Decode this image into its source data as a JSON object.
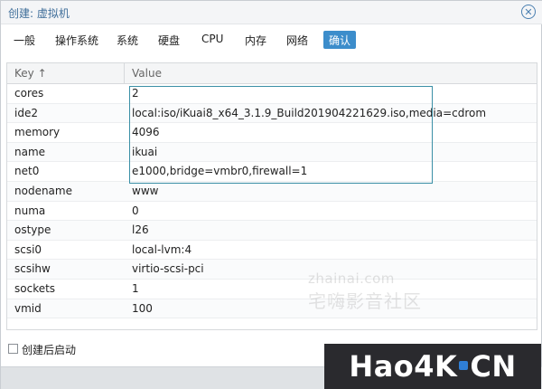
{
  "dialog": {
    "title": "创建: 虚拟机"
  },
  "tabs": [
    {
      "label": "一般"
    },
    {
      "label": "操作系统"
    },
    {
      "label": "系统"
    },
    {
      "label": "硬盘"
    },
    {
      "label": "CPU"
    },
    {
      "label": "内存"
    },
    {
      "label": "网络"
    },
    {
      "label": "确认"
    }
  ],
  "active_tab": "确认",
  "grid": {
    "columns": {
      "key": "Key ↑",
      "value": "Value"
    },
    "rows": [
      {
        "key": "cores",
        "value": "2"
      },
      {
        "key": "ide2",
        "value": "local:iso/iKuai8_x64_3.1.9_Build201904221629.iso,media=cdrom"
      },
      {
        "key": "memory",
        "value": "4096"
      },
      {
        "key": "name",
        "value": "ikuai"
      },
      {
        "key": "net0",
        "value": "e1000,bridge=vmbr0,firewall=1"
      },
      {
        "key": "nodename",
        "value": "www"
      },
      {
        "key": "numa",
        "value": "0"
      },
      {
        "key": "ostype",
        "value": "l26"
      },
      {
        "key": "scsi0",
        "value": "local-lvm:4"
      },
      {
        "key": "scsihw",
        "value": "virtio-scsi-pci"
      },
      {
        "key": "sockets",
        "value": "1"
      },
      {
        "key": "vmid",
        "value": "100"
      }
    ]
  },
  "footer": {
    "start_after_create_label": "创建后启动",
    "start_after_create_checked": false
  },
  "watermark": {
    "line1": "zhainai.com",
    "line2": "宅嗨影音社区"
  },
  "logo": {
    "part1": "Hao4K",
    "part2": "CN"
  },
  "colors": {
    "accent": "#3c8dcb",
    "title": "#3f6e9a",
    "highlight_border": "#3a8fa6"
  }
}
